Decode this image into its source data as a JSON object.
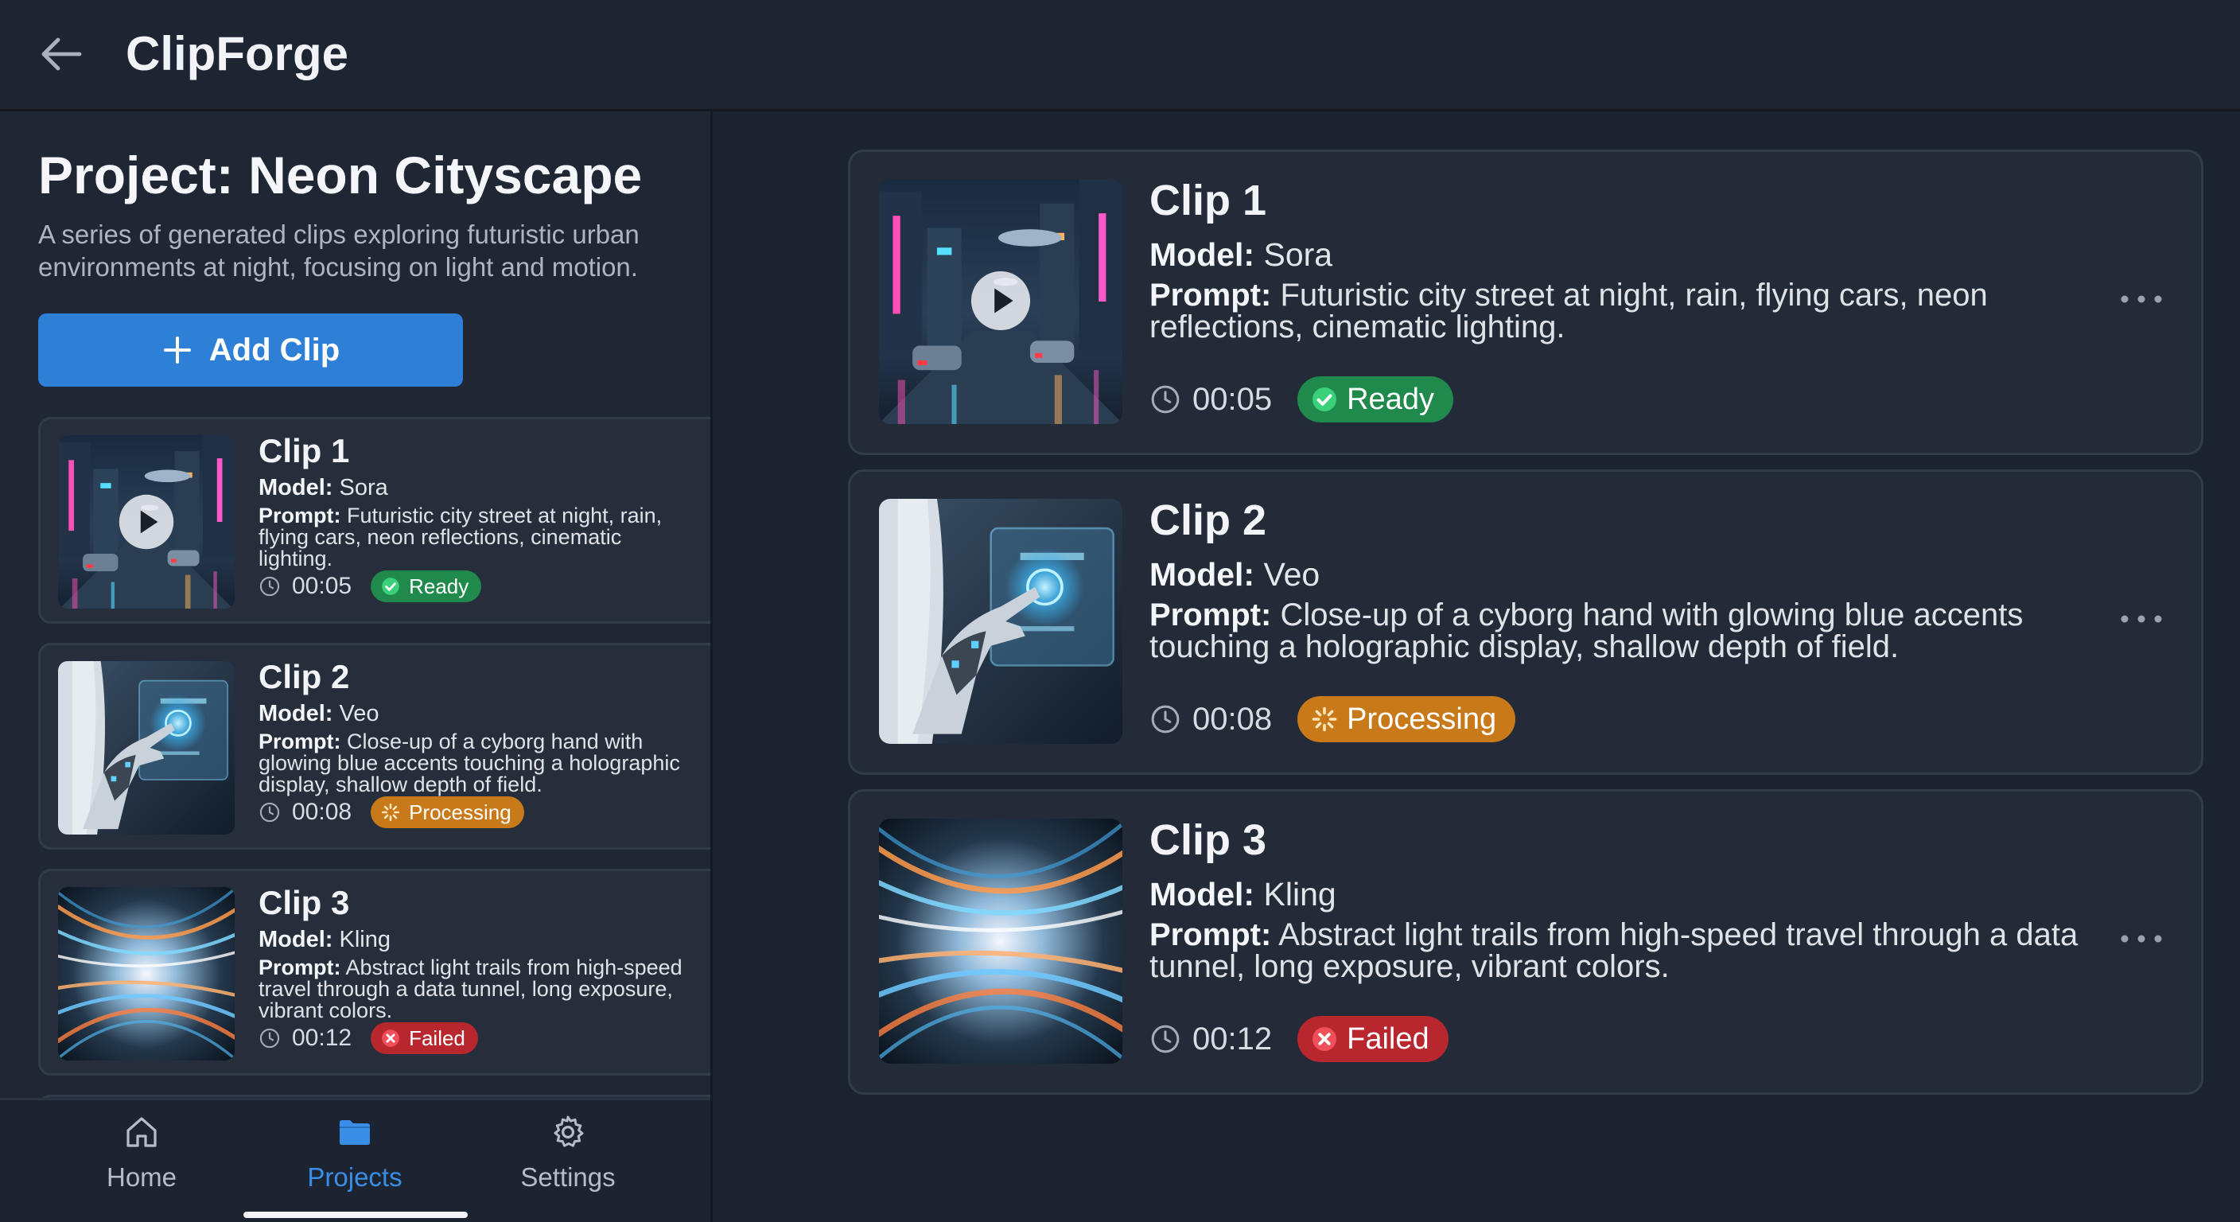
{
  "app": {
    "title": "ClipForge"
  },
  "project": {
    "title": "Project: Neon Cityscape",
    "description": "A series of generated clips exploring futuristic urban environments at night, focusing on light and motion.",
    "add_clip_label": "Add Clip"
  },
  "labels": {
    "model": "Model:",
    "prompt": "Prompt:"
  },
  "clips": [
    {
      "title": "Clip 1",
      "model": "Sora",
      "prompt": "Futuristic city street at night, rain, flying cars, neon reflections, cinematic lighting.",
      "duration": "00:05",
      "status": "Ready"
    },
    {
      "title": "Clip 2",
      "model": "Veo",
      "prompt": "Close-up of a cyborg hand with glowing blue accents touching a holographic display, shallow depth of field.",
      "duration": "00:08",
      "status": "Processing"
    },
    {
      "title": "Clip 3",
      "model": "Kling",
      "prompt": "Abstract light trails from high-speed travel through a data tunnel, long exposure, vibrant colors.",
      "duration": "00:12",
      "status": "Failed"
    }
  ],
  "nav": [
    {
      "label": "Home",
      "icon": "home-icon"
    },
    {
      "label": "Projects",
      "icon": "folder-icon",
      "active": true
    },
    {
      "label": "Settings",
      "icon": "gear-icon"
    }
  ],
  "colors": {
    "accent": "#2e7fd6",
    "ready": "#1f8a4c",
    "processing": "#c8791a",
    "failed": "#b8262e"
  }
}
